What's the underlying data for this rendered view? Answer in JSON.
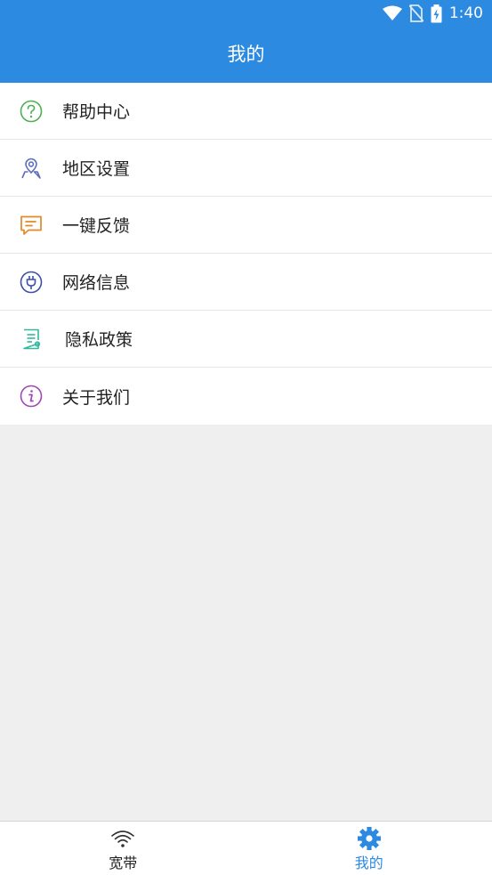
{
  "status_bar": {
    "time": "1:40",
    "icons": [
      "wifi-icon",
      "no-sim-icon",
      "battery-charging-icon"
    ]
  },
  "header": {
    "title": "我的"
  },
  "menu": {
    "items": [
      {
        "label": "帮助中心",
        "icon": "help-circle-icon",
        "color": "#4caf50"
      },
      {
        "label": "地区设置",
        "icon": "location-pin-icon",
        "color": "#5c6fb8"
      },
      {
        "label": "一键反馈",
        "icon": "feedback-message-icon",
        "color": "#e08a2a"
      },
      {
        "label": "网络信息",
        "icon": "plug-icon",
        "color": "#3b4fa8"
      },
      {
        "label": "隐私政策",
        "icon": "document-icon",
        "color": "#34b7a0"
      },
      {
        "label": "关于我们",
        "icon": "info-icon",
        "color": "#a146b8"
      }
    ]
  },
  "bottom_nav": {
    "tabs": [
      {
        "label": "宽带",
        "icon": "wifi-signal-icon",
        "active": false
      },
      {
        "label": "我的",
        "icon": "gear-icon",
        "active": true
      }
    ],
    "active_color": "#2c8ae0"
  },
  "theme": {
    "primary": "#2c8ae0",
    "background": "#efefef"
  }
}
